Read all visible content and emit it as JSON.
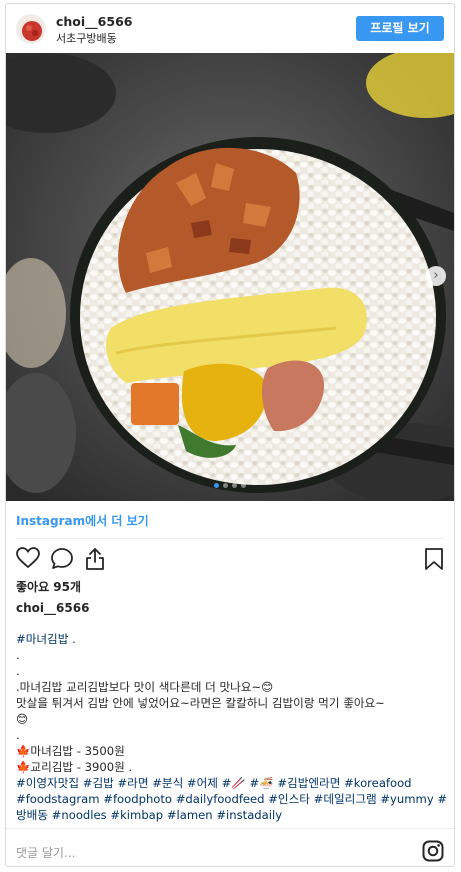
{
  "header": {
    "username": "choi__6566",
    "location": "서초구방배동",
    "profile_button": "프로필 보기"
  },
  "photo": {
    "alt_icon": "photo-kimbap",
    "slide_count": 4,
    "active_slide": 1,
    "next_icon": "chevron-right-icon"
  },
  "more_link": "Instagram에서 더 보기",
  "actions": {
    "like_icon": "heart-icon",
    "comment_icon": "comment-icon",
    "share_icon": "share-icon",
    "save_icon": "bookmark-icon"
  },
  "likes": "좋아요 95개",
  "author": "choi__6566",
  "caption": {
    "line1": "#마녀김밥 .",
    "line2": ".",
    "line3": ".",
    "line4": ".마녀김밥 교리김밥보다 맛이 색다른데 더 맛나요~😊",
    "line5": "맛살을 튀겨서 김밥 안에 넣었어요~라면은 칼칼하니 김밥이랑 먹기 좋아요~",
    "line6": "😊",
    "line7": ".",
    "line8": "🍁마녀김밥 - 3500원",
    "line9": "🍁교리김밥 - 3900원 .",
    "tags1": "#이영자맛집 #김밥 #라면 #분식 #어제 #🥢 #🍜 #김밥엔라면 #koreafood",
    "tags2": "#foodstagram #foodphoto #dailyfoodfeed #인스타 #데일리그램 #yummy #",
    "tags3": "방배동 #noodles #kimbap #lamen #instadaily"
  },
  "comment_placeholder": "댓글 달기...",
  "instagram_icon": "instagram-logo-icon"
}
